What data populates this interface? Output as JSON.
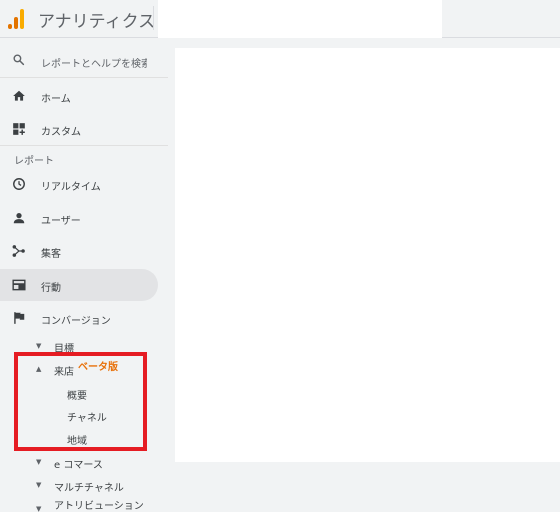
{
  "app": {
    "title": "アナリティクス"
  },
  "search": {
    "placeholder": "レポートとヘルプを検索"
  },
  "nav": {
    "home": "ホーム",
    "custom": "カスタム",
    "reports_label": "レポート",
    "realtime": "リアルタイム",
    "users": "ユーザー",
    "acquisition": "集客",
    "behavior": "行動",
    "conversions": "コンバージョン"
  },
  "conversions_sub": {
    "goals": "目標",
    "store_visits": "来店",
    "beta": "ベータ版",
    "overview": "概要",
    "channels": "チャネル",
    "regions": "地域",
    "ecommerce": "e コマース",
    "multichannel": "マルチチャネル",
    "attribution": "アトリビューション"
  },
  "colors": {
    "highlight": "#e51c23",
    "beta": "#e8710a",
    "logo_dark": "#e37400",
    "logo_light": "#f9ab00"
  }
}
